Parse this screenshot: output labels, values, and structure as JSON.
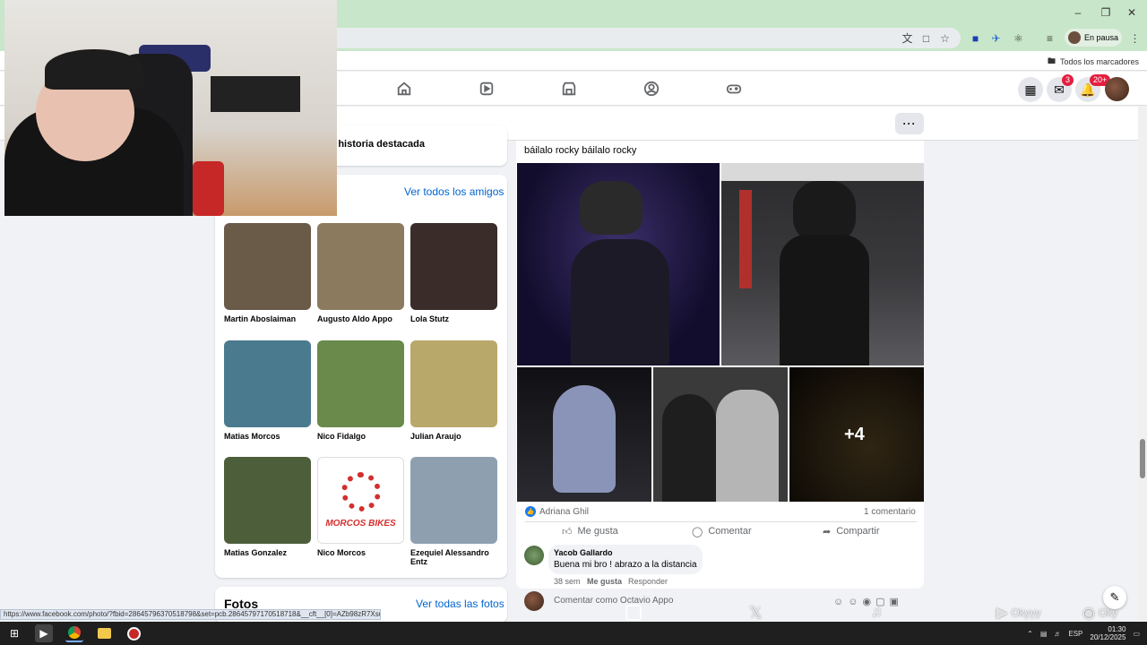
{
  "browser": {
    "profile_status": "En pausa",
    "bookmarks_all": "Todos los marcadores",
    "status_url": "https://www.facebook.com/photo/?fbid=28645796370518798&set=pcb.28645797170518718&__cft__[0]=AZb98zR7Xsu..."
  },
  "fb_nav": {
    "messenger_badge": "3",
    "notifications_badge": "20+"
  },
  "highlights": {
    "label": "r historia destacada"
  },
  "friends": {
    "see_all": "Ver todos los amigos",
    "items": [
      {
        "name": "Martin Aboslaiman",
        "color": "#6a5a48"
      },
      {
        "name": "Augusto Aldo Appo",
        "color": "#8b7a5e"
      },
      {
        "name": "Lola Stutz",
        "color": "#3a2c28"
      },
      {
        "name": "Matias Morcos",
        "color": "#4a7a8e"
      },
      {
        "name": "Nico Fidalgo",
        "color": "#6a8a4c"
      },
      {
        "name": "Julian Araujo",
        "color": "#b8a86a"
      },
      {
        "name": "Matias Gonzalez",
        "color": "#4c5e3a"
      },
      {
        "name": "Nico Morcos",
        "color": "#ffffff"
      },
      {
        "name": "Ezequiel Alessandro Entz",
        "color": "#8ea0b0"
      }
    ],
    "nico_morcos_logo": "MORCOS BIKES"
  },
  "photos": {
    "title": "Fotos",
    "see_all": "Ver todas las fotos"
  },
  "post": {
    "text": "báilalo rocky báilalo rocky",
    "more_photos": "+4",
    "liker": "Adriana Ghil",
    "comment_count": "1 comentario",
    "actions": {
      "like": "Me gusta",
      "comment": "Comentar",
      "share": "Compartir"
    },
    "comment": {
      "author": "Yacob Gallardo",
      "text": "Buena mi bro ! abrazo a la distancia",
      "age": "38 sem",
      "like": "Me gusta",
      "reply": "Responder"
    },
    "compose_placeholder": "Comentar como Octavio Appo"
  },
  "overlay_socials": [
    "",
    "",
    "",
    "Okyyy",
    "Oky"
  ],
  "taskbar": {
    "lang": "ESP",
    "time": "01:30",
    "date": "20/12/2025"
  }
}
